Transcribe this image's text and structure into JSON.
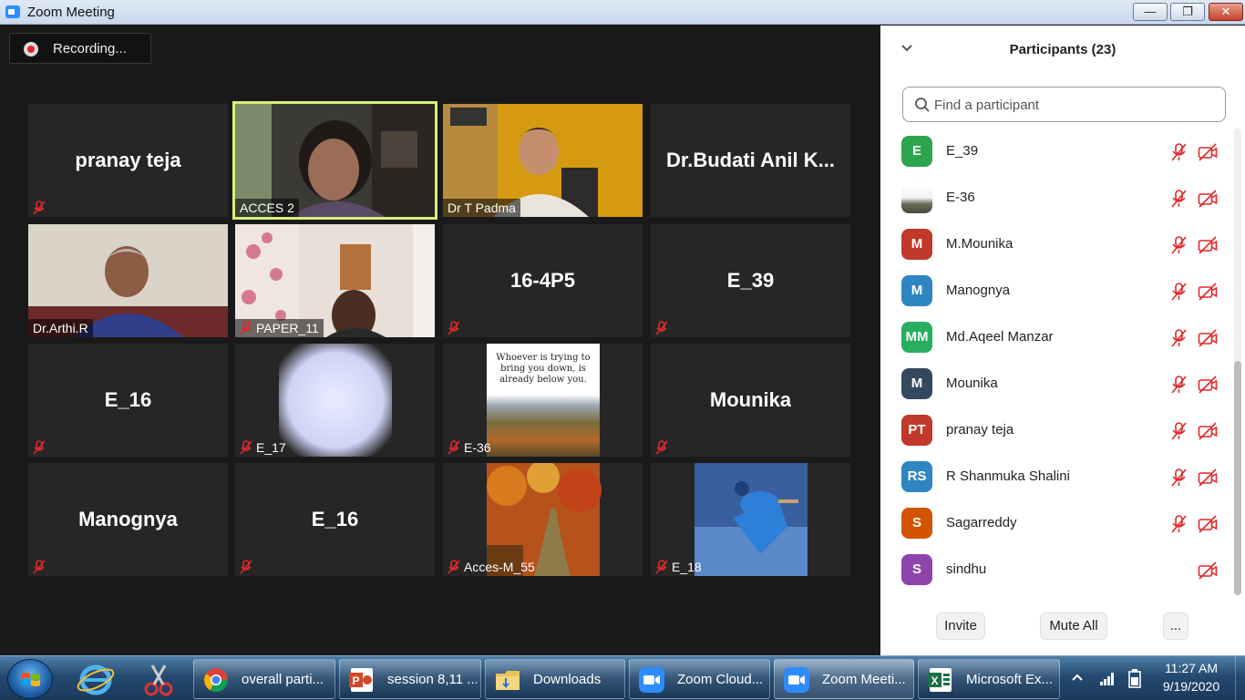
{
  "window": {
    "title": "Zoom Meeting"
  },
  "recording": {
    "label": "Recording..."
  },
  "tiles": [
    {
      "kind": "name",
      "display": "pranay teja",
      "caption": "",
      "muted": true
    },
    {
      "kind": "video",
      "display": "",
      "caption": "ACCES 2",
      "muted": false,
      "active": true
    },
    {
      "kind": "video",
      "display": "",
      "caption": "Dr T Padma",
      "muted": false
    },
    {
      "kind": "name",
      "display": "Dr.Budati Anil K...",
      "caption": "",
      "muted": false
    },
    {
      "kind": "video",
      "display": "",
      "caption": "Dr.Arthi.R",
      "muted": false
    },
    {
      "kind": "video",
      "display": "",
      "caption": "PAPER_11",
      "muted": true
    },
    {
      "kind": "name",
      "display": "16-4P5",
      "caption": "",
      "muted": true
    },
    {
      "kind": "name",
      "display": "E_39",
      "caption": "",
      "muted": true
    },
    {
      "kind": "name",
      "display": "E_16",
      "caption": "",
      "muted": true
    },
    {
      "kind": "video",
      "display": "",
      "caption": "E_17",
      "muted": true
    },
    {
      "kind": "video",
      "display": "",
      "caption": "E-36",
      "muted": true,
      "quote": "Whoever is trying to bring you down, is already below you."
    },
    {
      "kind": "name",
      "display": "Mounika",
      "caption": "",
      "muted": true
    },
    {
      "kind": "name",
      "display": "Manognya",
      "caption": "",
      "muted": true
    },
    {
      "kind": "name",
      "display": "E_16",
      "caption": "",
      "muted": true
    },
    {
      "kind": "video",
      "display": "",
      "caption": "Acces-M_55",
      "muted": true
    },
    {
      "kind": "video",
      "display": "",
      "caption": "E_18",
      "muted": true
    }
  ],
  "participants": {
    "title": "Participants (23)",
    "search_placeholder": "Find a participant",
    "list": [
      {
        "initials": "E",
        "name": "E_39",
        "color": "#2ea44f",
        "mic_muted": true,
        "cam_off": true
      },
      {
        "initials": "",
        "name": "E-36",
        "color": "#8a8f7a",
        "mic_muted": true,
        "cam_off": true,
        "image_avatar": true
      },
      {
        "initials": "M",
        "name": "M.Mounika",
        "color": "#c0392b",
        "mic_muted": true,
        "cam_off": true
      },
      {
        "initials": "M",
        "name": "Manognya",
        "color": "#2e86c1",
        "mic_muted": true,
        "cam_off": true
      },
      {
        "initials": "MM",
        "name": "Md.Aqeel Manzar",
        "color": "#27ae60",
        "mic_muted": true,
        "cam_off": true
      },
      {
        "initials": "M",
        "name": "Mounika",
        "color": "#34495e",
        "mic_muted": true,
        "cam_off": true
      },
      {
        "initials": "PT",
        "name": "pranay teja",
        "color": "#c0392b",
        "mic_muted": true,
        "cam_off": true
      },
      {
        "initials": "RS",
        "name": "R Shanmuka Shalini",
        "color": "#2e86c1",
        "mic_muted": true,
        "cam_off": true
      },
      {
        "initials": "S",
        "name": "Sagarreddy",
        "color": "#d35400",
        "mic_muted": true,
        "cam_off": true
      },
      {
        "initials": "S",
        "name": "sindhu",
        "color": "#8e44ad",
        "mic_muted": false,
        "cam_off": true
      }
    ],
    "invite_label": "Invite",
    "mute_all_label": "Mute All",
    "more_label": "..."
  },
  "taskbar": {
    "items": [
      {
        "label": "overall parti...",
        "icon": "chrome-icon"
      },
      {
        "label": "session 8,11 ...",
        "icon": "powerpoint-icon"
      },
      {
        "label": "Downloads",
        "icon": "folder-icon"
      },
      {
        "label": "Zoom Cloud...",
        "icon": "zoom-icon"
      },
      {
        "label": "Zoom Meeti...",
        "icon": "zoom-icon",
        "active": true
      },
      {
        "label": "Microsoft Ex...",
        "icon": "excel-icon"
      }
    ],
    "time": "11:27 AM",
    "date": "9/19/2020"
  },
  "colors": {
    "accent": "#2d8cff",
    "active_speaker": "#d6f07a",
    "muted_red": "#e02828"
  }
}
